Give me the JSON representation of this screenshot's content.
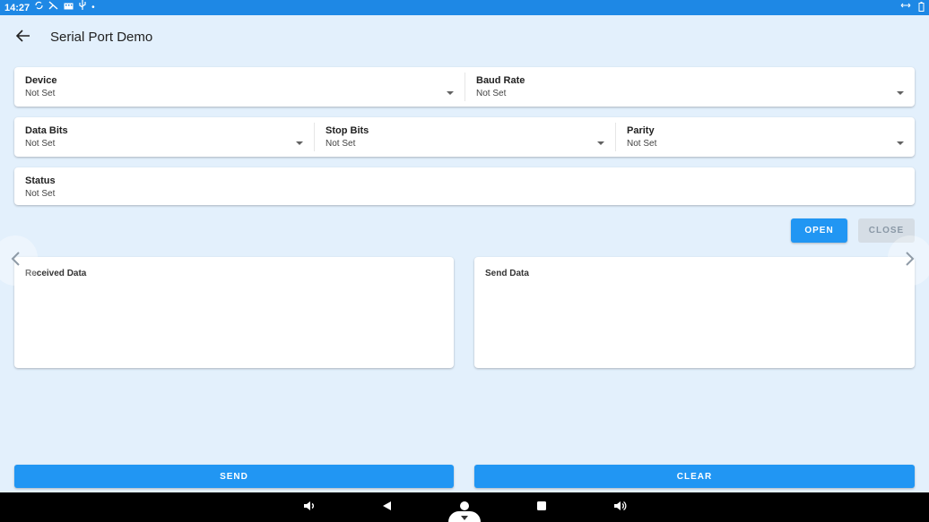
{
  "status_bar": {
    "time": "14:27",
    "icons": [
      "sync-icon",
      "signal-icon",
      "keyboard-icon",
      "usb-icon",
      "dot-icon"
    ],
    "right_icons": [
      "data-transfer-icon",
      "battery-icon"
    ]
  },
  "app_bar": {
    "title": "Serial Port Demo",
    "back_icon": "arrow-back-icon"
  },
  "settings": {
    "device": {
      "label": "Device",
      "value": "Not Set"
    },
    "baud_rate": {
      "label": "Baud Rate",
      "value": "Not Set"
    },
    "data_bits": {
      "label": "Data Bits",
      "value": "Not Set"
    },
    "stop_bits": {
      "label": "Stop Bits",
      "value": "Not Set"
    },
    "parity": {
      "label": "Parity",
      "value": "Not Set"
    },
    "status": {
      "label": "Status",
      "value": "Not Set"
    }
  },
  "actions": {
    "open_label": "OPEN",
    "close_label": "CLOSE"
  },
  "panels": {
    "received_title": "Received Data",
    "send_title": "Send Data"
  },
  "bottom_buttons": {
    "send_label": "SEND",
    "clear_label": "CLEAR"
  },
  "colors": {
    "background": "#e3f0fc",
    "status_bar": "#1e88e5",
    "primary_button": "#2196f3",
    "disabled_button": "#d5dde5",
    "nav_bar": "#000000"
  },
  "nav_bar": {
    "icons": [
      "volume-down-icon",
      "back-triangle-icon",
      "home-icon",
      "recents-icon",
      "volume-up-icon"
    ]
  }
}
